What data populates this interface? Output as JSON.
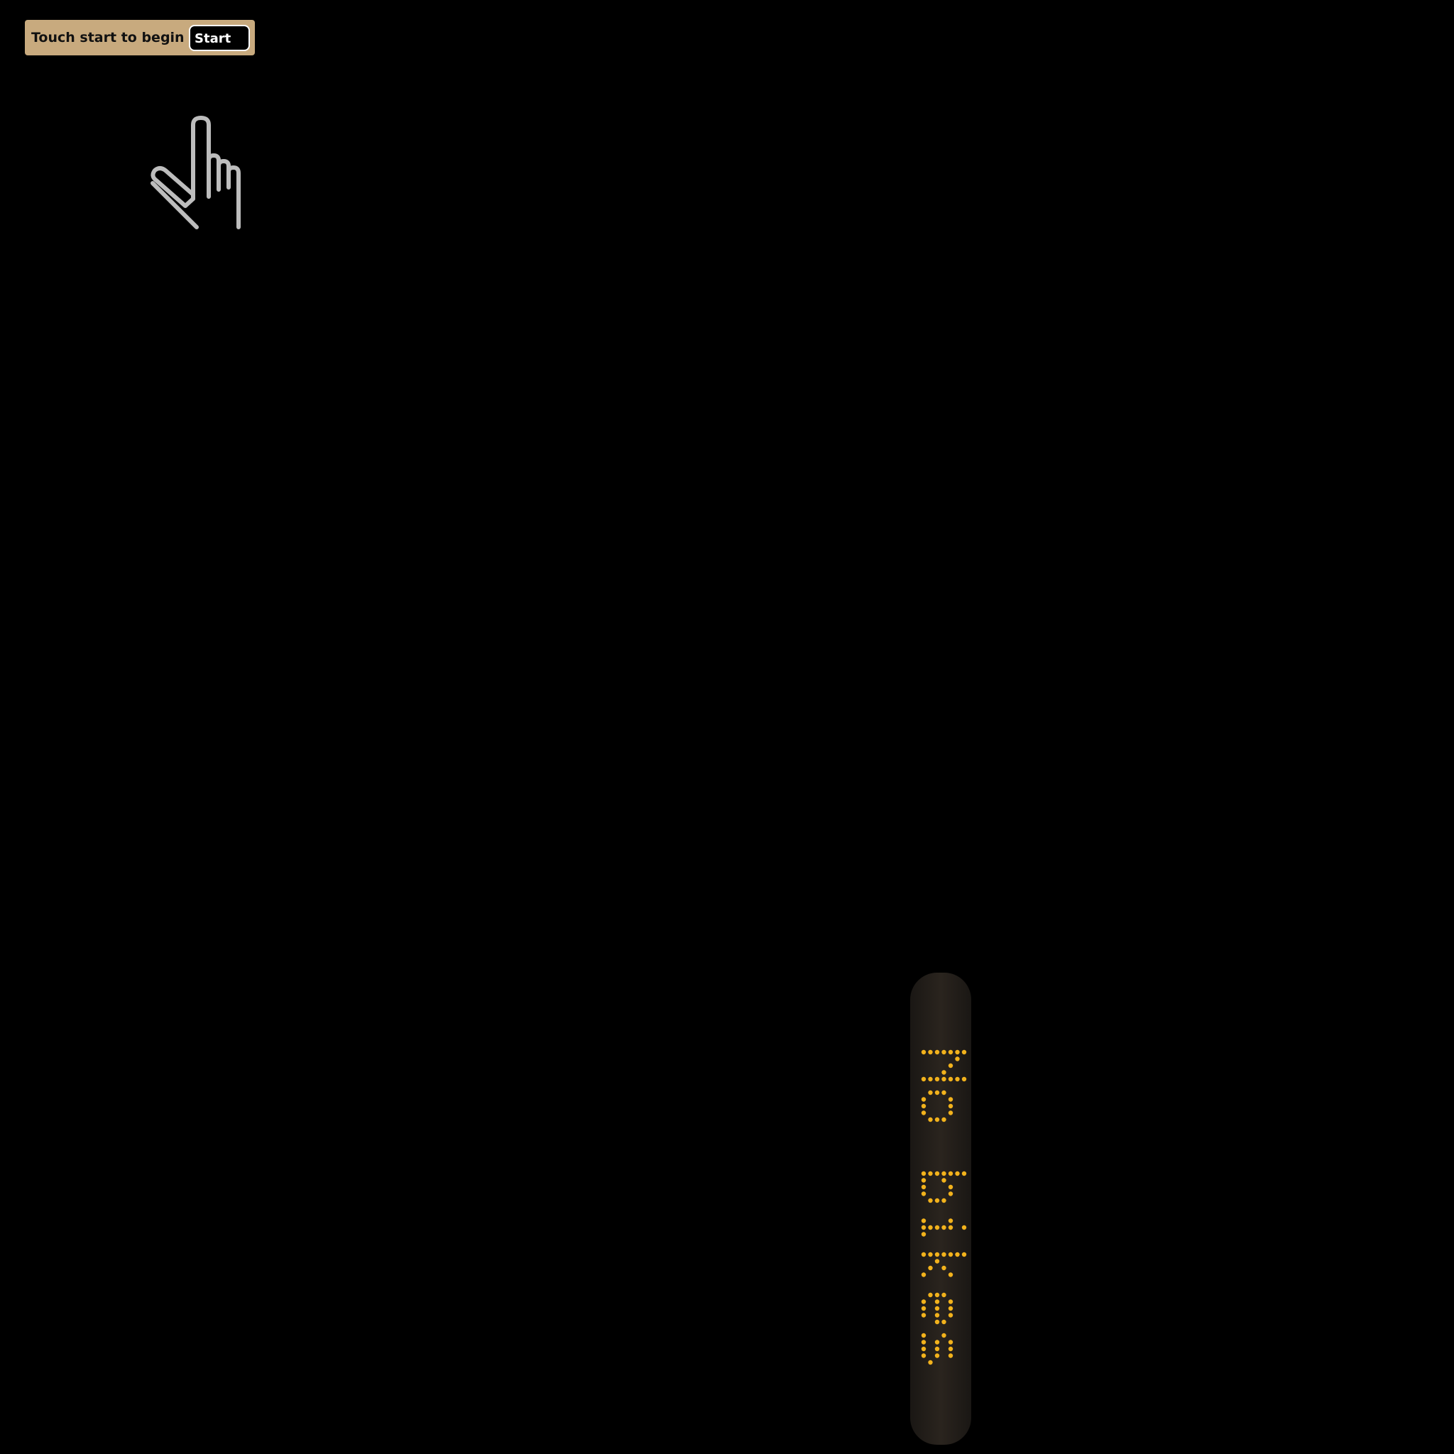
{
  "prompt": {
    "message": "Touch start to begin",
    "start_label": "Start"
  },
  "sign": {
    "text": "No bikes",
    "led_color": "#f2b21c"
  },
  "colors": {
    "background": "#000000",
    "prompt_bar": "#c8aa7e",
    "hand_icon": "#bdbdbd"
  },
  "icons": {
    "pointer": "pointing-hand-icon"
  }
}
